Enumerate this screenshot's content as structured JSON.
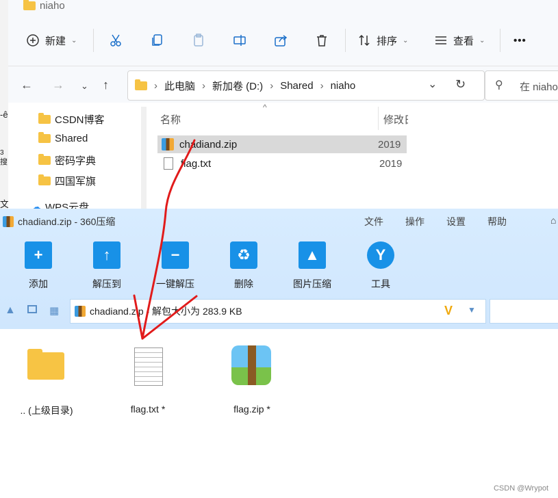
{
  "explorer": {
    "title": "niaho",
    "toolbar": {
      "new_label": "新建",
      "sort_label": "排序",
      "view_label": "查看",
      "more_label": "•••"
    },
    "breadcrumb": [
      "此电脑",
      "新加卷 (D:)",
      "Shared",
      "niaho"
    ],
    "search_placeholder": "在 niaho",
    "nav_items": [
      "CSDN博客",
      "Shared",
      "密码字典",
      "四国军旗",
      "WPS云盘"
    ],
    "columns": {
      "name": "名称",
      "modified": "修改日"
    },
    "files": [
      {
        "name": "chadiand.zip",
        "modified": "2019"
      },
      {
        "name": "flag.txt",
        "modified": "2019"
      }
    ]
  },
  "zip_window": {
    "title": "chadiand.zip - 360压缩",
    "menu": [
      "文件",
      "操作",
      "设置",
      "帮助"
    ],
    "tools": [
      "添加",
      "解压到",
      "一键解压",
      "删除",
      "图片压缩",
      "工具"
    ],
    "address": "chadiand.zip - 解包大小为 283.9 KB",
    "items": [
      {
        "label": ".. (上级目录)",
        "icon": "folder-icon"
      },
      {
        "label": "flag.txt *",
        "icon": "text-file-icon"
      },
      {
        "label": "flag.zip *",
        "icon": "archive-icon"
      }
    ]
  },
  "watermark": "CSDN @Wrypot",
  "colors": {
    "accent": "#1891e7",
    "annotation": "#e11b1b",
    "folder": "#f6c344"
  }
}
